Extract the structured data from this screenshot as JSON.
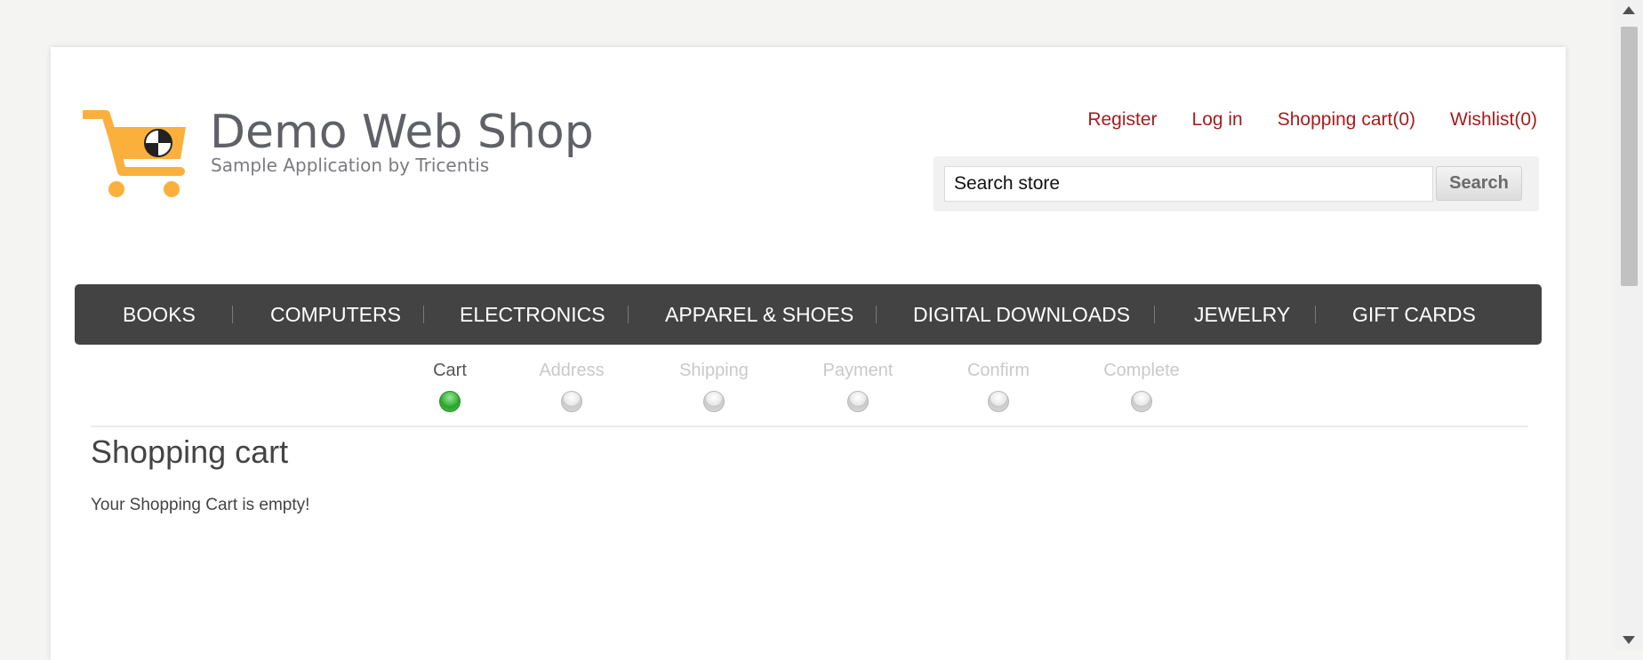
{
  "brand": {
    "title": "Demo Web Shop",
    "subtitle": "Sample Application by Tricentis",
    "logo_icon": "shopping-cart-icon",
    "logo_color": "#fbb03b"
  },
  "header": {
    "links": {
      "register": "Register",
      "login": "Log in",
      "cart": "Shopping cart(0)",
      "wishlist": "Wishlist(0)"
    },
    "link_color": "#a41d1d"
  },
  "search": {
    "value": "Search store",
    "button_label": "Search"
  },
  "menu": {
    "items": [
      "BOOKS",
      "COMPUTERS",
      "ELECTRONICS",
      "APPAREL & SHOES",
      "DIGITAL DOWNLOADS",
      "JEWELRY",
      "GIFT CARDS"
    ],
    "background": "#434343"
  },
  "checkout_steps": {
    "steps": [
      "Cart",
      "Address",
      "Shipping",
      "Payment",
      "Confirm",
      "Complete"
    ],
    "active_index": 0,
    "active_color": "#3fba3f"
  },
  "main": {
    "title": "Shopping cart",
    "empty_message": "Your Shopping Cart is empty!"
  }
}
